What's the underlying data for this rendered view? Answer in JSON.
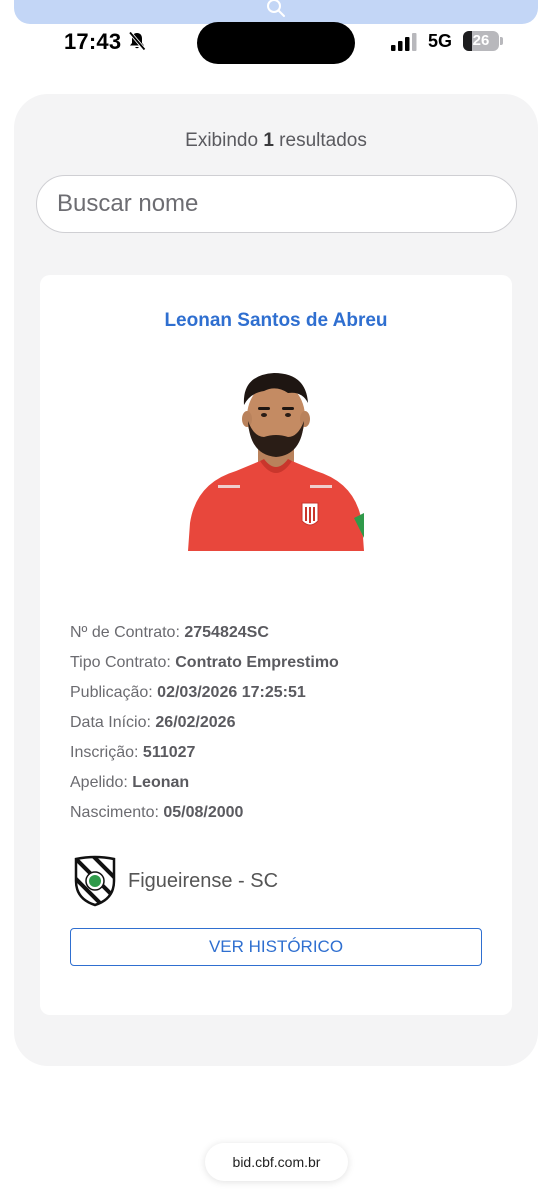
{
  "status_bar": {
    "time": "17:43",
    "network": "5G",
    "battery": "26",
    "battery_level": 0.26
  },
  "results": {
    "prefix": "Exibindo",
    "count": "1",
    "suffix": "resultados"
  },
  "search": {
    "placeholder": "Buscar nome"
  },
  "player": {
    "name": "Leonan Santos de Abreu",
    "fields": [
      {
        "label": "Nº de Contrato:",
        "value": "2754824SC"
      },
      {
        "label": "Tipo Contrato:",
        "value": "Contrato Emprestimo"
      },
      {
        "label": "Publicação:",
        "value": "02/03/2026 17:25:51"
      },
      {
        "label": "Data Início:",
        "value": "26/02/2026"
      },
      {
        "label": "Inscrição:",
        "value": "511027"
      },
      {
        "label": "Apelido:",
        "value": "Leonan"
      },
      {
        "label": "Nascimento:",
        "value": "05/08/2000"
      }
    ],
    "club": "Figueirense - SC",
    "history_button": "VER HISTÓRICO"
  },
  "browser": {
    "url": "bid.cbf.com.br"
  },
  "colors": {
    "accent": "#2f6fd0",
    "panel": "#f4f4f5",
    "jersey": "#e8473c"
  }
}
